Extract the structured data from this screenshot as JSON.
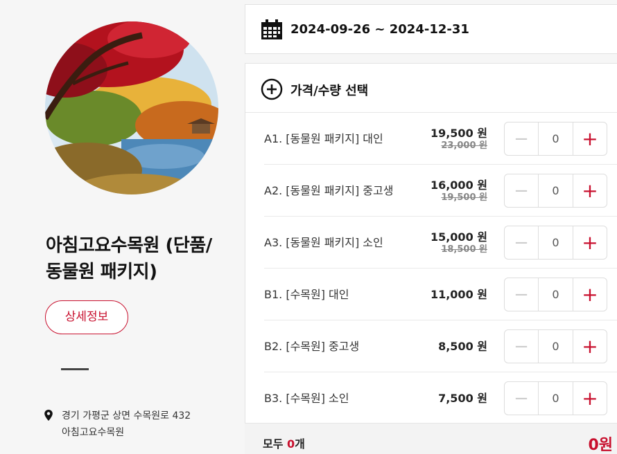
{
  "product": {
    "title": "아침고요수목원 (단품/동물원 패키지)",
    "detail_button": "상세정보",
    "address_line1": "경기 가평군 상면 수목원로 432",
    "address_line2": "아침고요수목원"
  },
  "date_range": "2024-09-26 ~ 2024-12-31",
  "options": {
    "title": "가격/수량 선택",
    "rows": [
      {
        "name": "A1. [동물원 패키지] 대인",
        "price": "19,500 원",
        "original": "23,000 원",
        "qty": "0"
      },
      {
        "name": "A2. [동물원 패키지] 중고생",
        "price": "16,000 원",
        "original": "19,500 원",
        "qty": "0"
      },
      {
        "name": "A3. [동물원 패키지] 소인",
        "price": "15,000 원",
        "original": "18,500 원",
        "qty": "0"
      },
      {
        "name": "B1. [수목원] 대인",
        "price": "11,000 원",
        "original": "",
        "qty": "0"
      },
      {
        "name": "B2. [수목원] 중고생",
        "price": "8,500 원",
        "original": "",
        "qty": "0"
      },
      {
        "name": "B3. [수목원] 소인",
        "price": "7,500 원",
        "original": "",
        "qty": "0"
      }
    ]
  },
  "footer": {
    "count_prefix": "모두 ",
    "count": "0",
    "count_suffix": "개",
    "total": "0원"
  },
  "icons": {
    "calendar": "calendar-icon",
    "add": "plus-circle-icon",
    "location": "map-pin-icon",
    "minus": "minus-icon",
    "plus": "plus-icon"
  },
  "colors": {
    "accent": "#c8102e",
    "background": "#f6f6f6"
  }
}
